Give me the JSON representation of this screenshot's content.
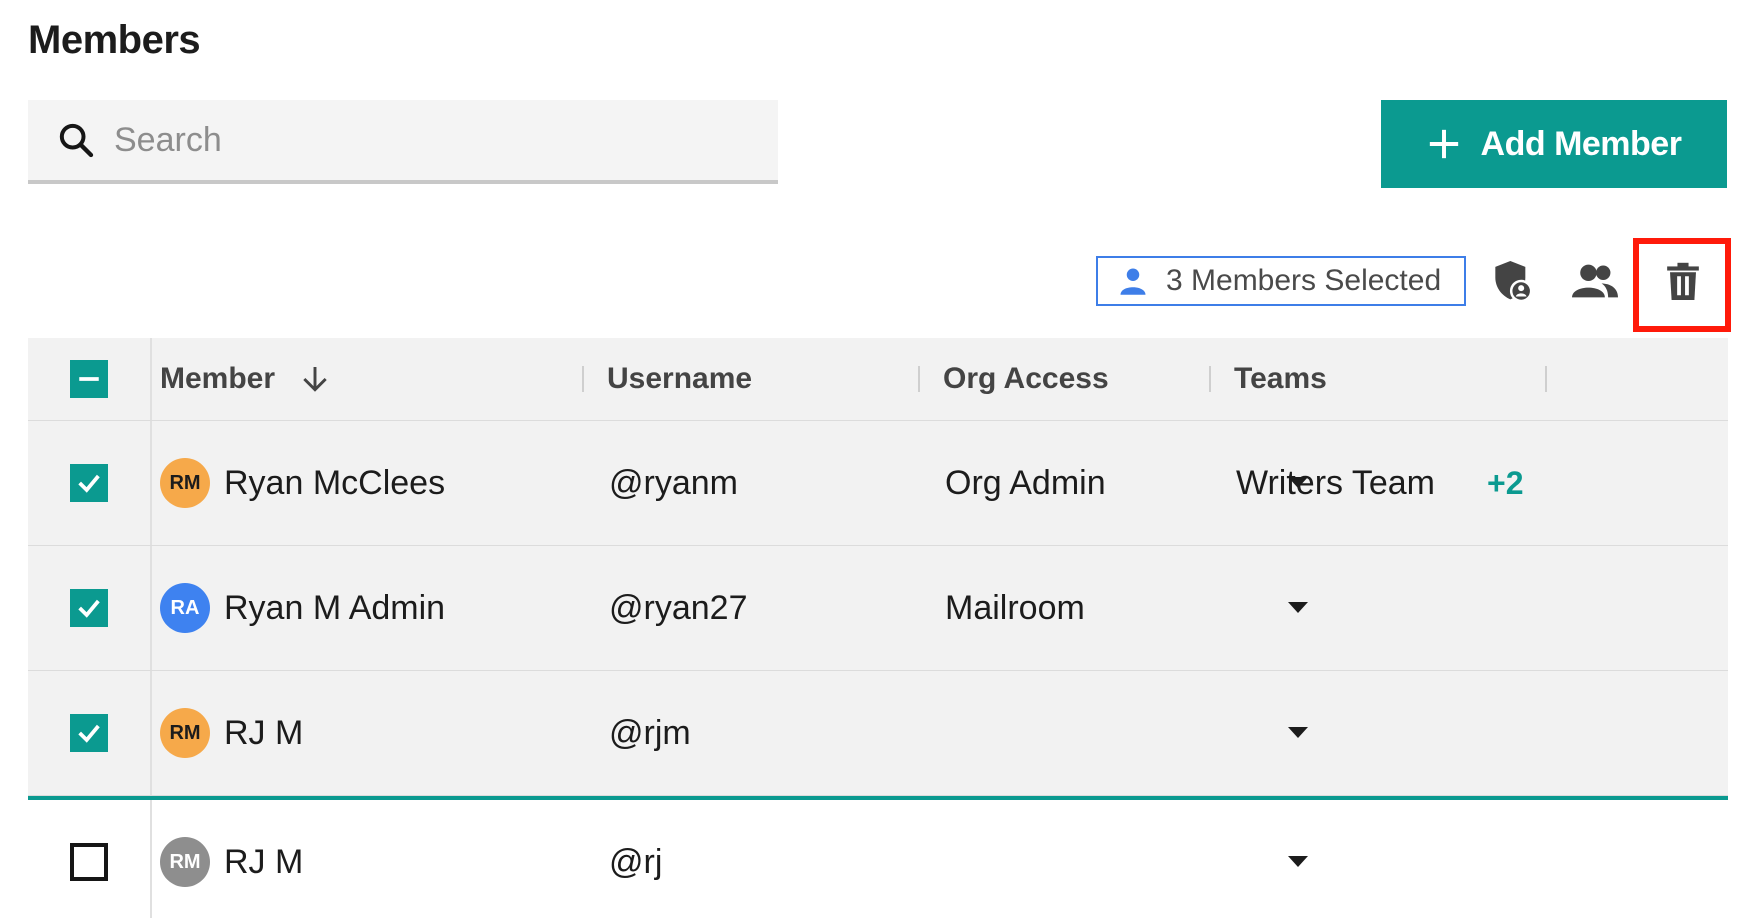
{
  "page": {
    "title": "Members"
  },
  "search": {
    "placeholder": "Search",
    "value": ""
  },
  "actions": {
    "add_member_label": "Add Member",
    "selection_label": "3 Members Selected"
  },
  "colors": {
    "accent": "#0b9a90",
    "chip_border": "#3e7ee8",
    "highlight": "#ff1a0a"
  },
  "table": {
    "columns": [
      "Member",
      "Username",
      "Org Access",
      "Teams"
    ],
    "sort": {
      "column": "Member",
      "direction": "descending-arrow"
    },
    "rows": [
      {
        "selected": true,
        "initials": "RM",
        "avatar_color": "orange",
        "name": "Ryan McClees",
        "username": "@ryanm",
        "org_access": "Org Admin",
        "team": "Writers Team",
        "more_teams": "+2"
      },
      {
        "selected": true,
        "initials": "RA",
        "avatar_color": "blue",
        "name": "Ryan M Admin",
        "username": "@ryan27",
        "org_access": "Mailroom",
        "team": "",
        "more_teams": ""
      },
      {
        "selected": true,
        "initials": "RM",
        "avatar_color": "orange",
        "name": "RJ M",
        "username": "@rjm",
        "org_access": "",
        "team": "",
        "more_teams": ""
      },
      {
        "selected": false,
        "initials": "RM",
        "avatar_color": "gray",
        "name": "RJ M",
        "username": "@rj",
        "org_access": "",
        "team": "",
        "more_teams": ""
      }
    ]
  },
  "icons": [
    "search-icon",
    "plus-icon",
    "person-icon",
    "shield-user-icon",
    "users-icon",
    "trash-icon",
    "arrow-down-icon",
    "caret-down-icon",
    "check-icon",
    "minus-icon"
  ]
}
